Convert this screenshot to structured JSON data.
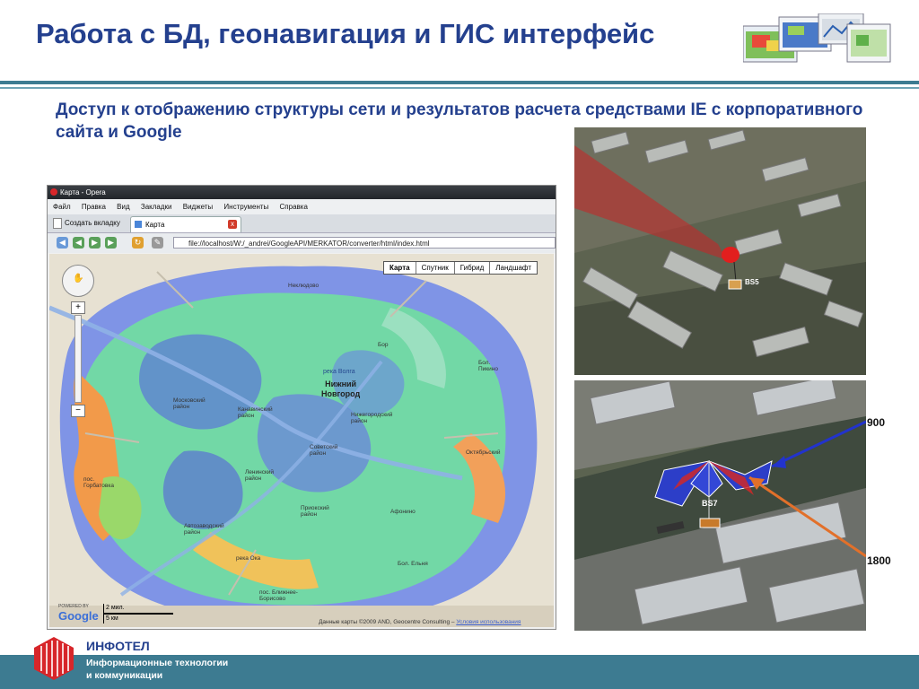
{
  "slide": {
    "title": "Работа с БД, геонавигация и ГИС интерфейс",
    "subtitle": "Доступ к отображению структуры сети и результатов расчета средствами  IE с корпоративного сайта и Google"
  },
  "browser": {
    "window_title": "Карта - Opera",
    "menu": [
      "Файл",
      "Правка",
      "Вид",
      "Закладки",
      "Виджеты",
      "Инструменты",
      "Справка"
    ],
    "new_tab_label": "Создать вкладку",
    "tab_label": "Карта",
    "tab_close": "x",
    "url": "file://localhost/W:/_andrei/GoogleAPI/MERKATOR/converter/html/index.html",
    "map_types": [
      "Карта",
      "Спутник",
      "Гибрид",
      "Ландшафт"
    ]
  },
  "map": {
    "labels": [
      "Неклюдово",
      "Бор",
      "Бол. Пикино",
      "Октябрьский",
      "Афонино",
      "Бол. Ельня",
      "пос. Горбатовка",
      "Автозаводский район",
      "Ленинский район",
      "Приокский район",
      "река Ока",
      "пос. Ближнее-Борисово",
      "Московский район",
      "Канавинский район",
      "Советский район",
      "Нижегородский район"
    ],
    "river_label": "река Волга",
    "city_line1": "Нижний",
    "city_line2": "Новгород",
    "zoom_plus": "+",
    "zoom_minus": "−",
    "powered_by": "POWERED BY",
    "google_logo": "Google",
    "scale_miles": "2 мил.",
    "scale_km": "5 км",
    "copyright": "Данные карты ©2009 AND, Geocentre Consulting – ",
    "terms_link": "Условия использования"
  },
  "photos": {
    "top_station": "BS5",
    "bottom_station": "BS7",
    "freq_900": "900",
    "freq_1800": "1800"
  },
  "footer": {
    "brand": "ИНФОТЕЛ",
    "line1": "Информационные технологии",
    "line2": "и коммуникации"
  },
  "colors": {
    "title": "#24408e",
    "footer_band": "#3d7b91",
    "rule": "#3d7b91"
  }
}
